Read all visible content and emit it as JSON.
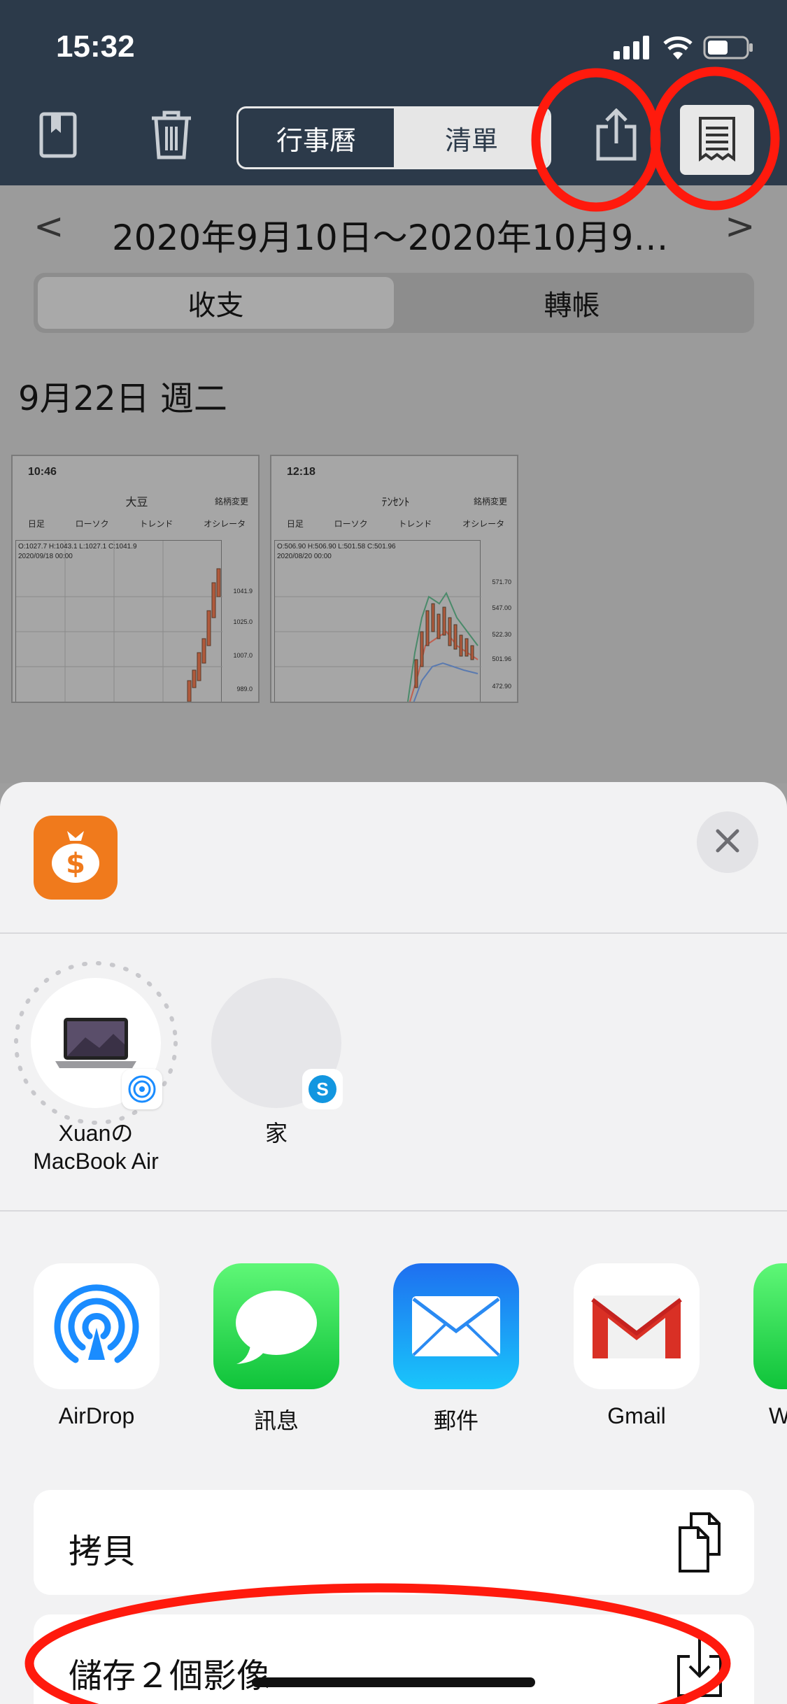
{
  "status_bar": {
    "time": "15:32"
  },
  "toolbar": {
    "segment_calendar": "行事曆",
    "segment_list": "清單"
  },
  "date_nav": {
    "range": "2020年9月10日～2020年10月9…",
    "prev": "<",
    "next": ">"
  },
  "type_segment": {
    "income_expense": "收支",
    "transfer": "轉帳"
  },
  "day_header": "9月22日 週二",
  "thumbnails": [
    {
      "time": "10:46",
      "title": "大豆",
      "right": "銘柄変更",
      "tabs": [
        "日足",
        "ローソク",
        "トレンド",
        "オシレータ"
      ],
      "info": "O:1027.7    H:1043.1    L:1027.1    C:1041.9",
      "date": "2020/09/18 00:00",
      "axis": [
        "1041.9",
        "1025.0",
        "1007.0",
        "989.0"
      ]
    },
    {
      "time": "12:18",
      "title": "ﾃﾝｾﾝﾄ",
      "right": "銘柄変更",
      "tabs": [
        "日足",
        "ローソク",
        "トレンド",
        "オシレータ"
      ],
      "info": "O:506.90    H:506.90    L:501.58    C:501.96",
      "date": "2020/08/20 00:00",
      "axis": [
        "571.70",
        "547.00",
        "522.30",
        "501.96",
        "472.90"
      ]
    }
  ],
  "share_sheet": {
    "people": [
      {
        "name": "Xuanの\nMacBook Air"
      },
      {
        "name": "家"
      }
    ],
    "apps": [
      {
        "label": "AirDrop"
      },
      {
        "label": "訊息"
      },
      {
        "label": "郵件"
      },
      {
        "label": "Gmail"
      },
      {
        "label": "W"
      }
    ],
    "actions": [
      {
        "label": "拷貝"
      },
      {
        "label": "儲存２個影像"
      }
    ]
  },
  "colors": {
    "brand_orange": "#f07a1c",
    "nav_dark": "#2c3a4a",
    "annotation_red": "#ff1a0d"
  }
}
